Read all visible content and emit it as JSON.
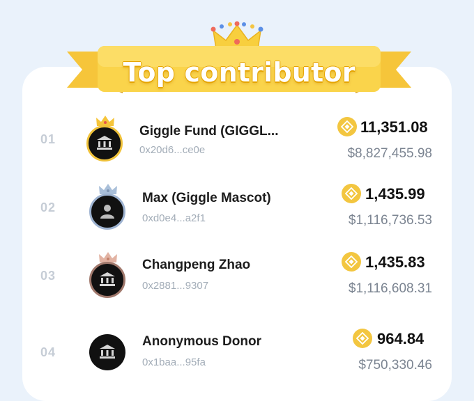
{
  "banner": {
    "title": "Top contributor"
  },
  "colors": {
    "accent": "#f6c73b",
    "coin": "#f3c640",
    "bg": "#eaf2fb"
  },
  "contributors": [
    {
      "rank": "01",
      "name": "Giggle Fund (GIGGL...",
      "address": "0x20d6...ce0e",
      "amount": "11,351.08",
      "usd": "$8,827,455.98",
      "crown": "gold"
    },
    {
      "rank": "02",
      "name": "Max (Giggle Mascot)",
      "address": "0xd0e4...a2f1",
      "amount": "1,435.99",
      "usd": "$1,116,736.53",
      "crown": "silver"
    },
    {
      "rank": "03",
      "name": "Changpeng Zhao",
      "address": "0x2881...9307",
      "amount": "1,435.83",
      "usd": "$1,116,608.31",
      "crown": "bronze"
    },
    {
      "rank": "04",
      "name": "Anonymous Donor",
      "address": "0x1baa...95fa",
      "amount": "964.84",
      "usd": "$750,330.46",
      "crown": "none"
    }
  ]
}
